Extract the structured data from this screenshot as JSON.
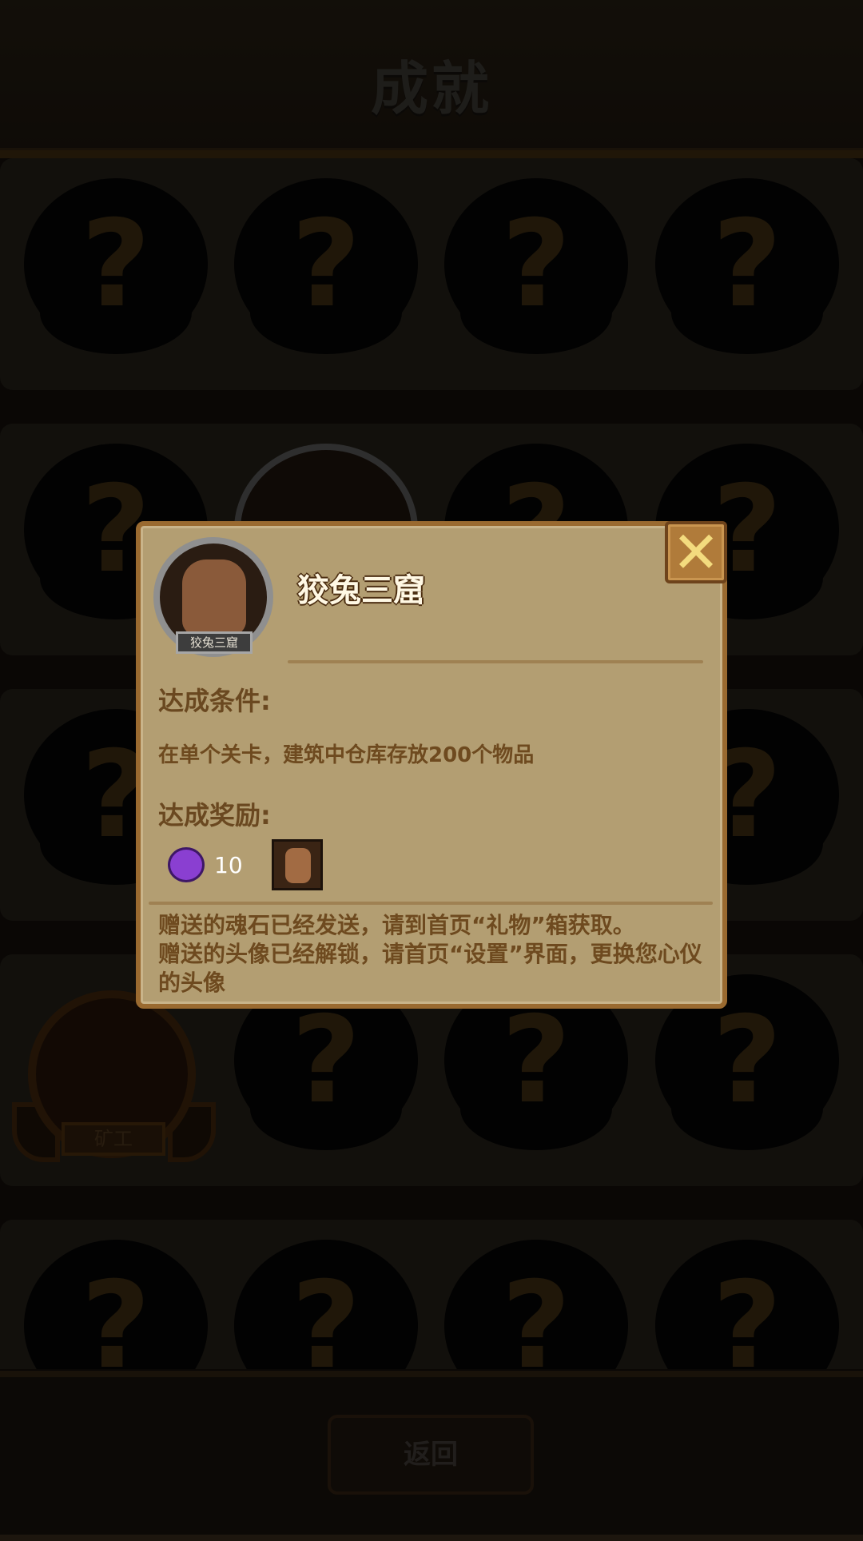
{
  "header": {
    "title": "成就"
  },
  "grid": {
    "locked_symbol": "?",
    "unlocked": [
      {
        "label": "矿工"
      }
    ]
  },
  "modal": {
    "title": "狡兔三窟",
    "avatar_caption": "狡兔三窟",
    "close_symbol": "✕",
    "condition_label": "达成条件:",
    "condition_text": "在单个关卡，建筑中仓库存放200个物品",
    "reward_label": "达成奖励:",
    "reward_soulstone_count": "10",
    "notice_line1": "赠送的魂石已经发送，请到首页“礼物”箱获取。",
    "notice_line2": "赠送的头像已经解锁，请首页“设置”界面，更换您心仪的头像"
  },
  "footer": {
    "back_label": "返回"
  },
  "colors": {
    "panel": "#b39e72",
    "panel_border": "#9a6a30",
    "accent_text": "#6a4820",
    "reward_gem": "#8a3fd1"
  }
}
